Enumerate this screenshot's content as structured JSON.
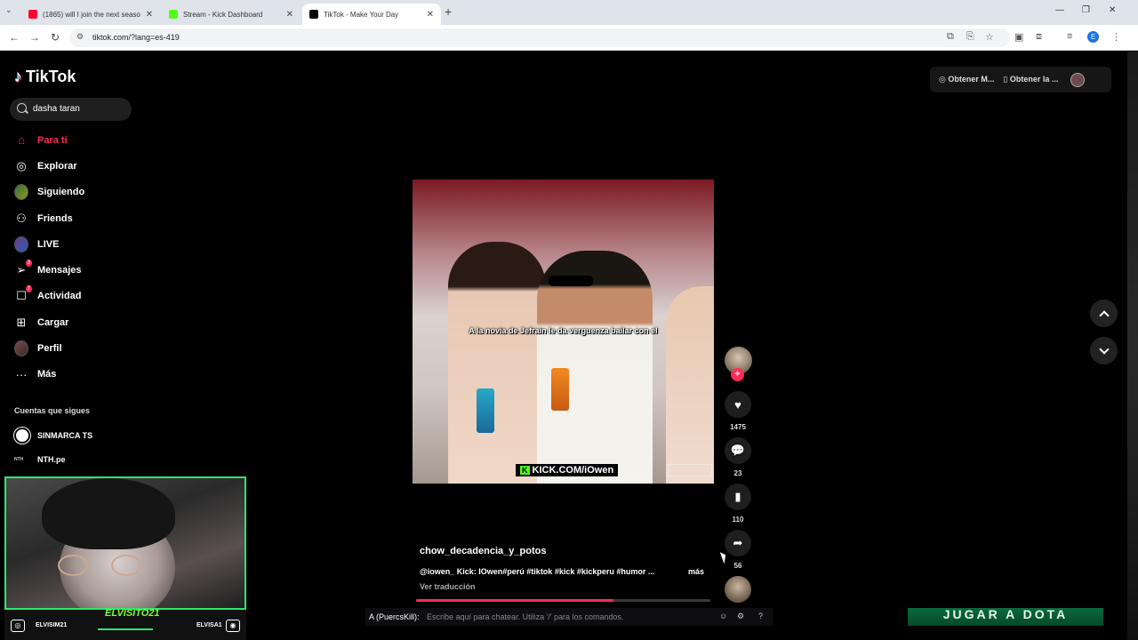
{
  "browser": {
    "tabs": [
      {
        "label": "(1865) will I join the next season",
        "favicon_color": "#ff0033"
      },
      {
        "label": "Stream - Kick Dashboard",
        "favicon_color": "#53fc18"
      },
      {
        "label": "TikTok - Make Your Day",
        "favicon_color": "#000000"
      }
    ],
    "url": "tiktok.com/?lang=es-419",
    "profile_letter": "E"
  },
  "tiktok": {
    "logo": "TikTok",
    "search_value": "dasha taran",
    "nav": [
      {
        "label": "Para ti",
        "icon": "home-icon",
        "active": true
      },
      {
        "label": "Explorar",
        "icon": "compass-icon"
      },
      {
        "label": "Siguiendo",
        "icon": "following-avatar-icon"
      },
      {
        "label": "Friends",
        "icon": "friends-icon"
      },
      {
        "label": "LIVE",
        "icon": "live-avatar-icon"
      },
      {
        "label": "Mensajes",
        "icon": "send-icon",
        "badge": "3"
      },
      {
        "label": "Actividad",
        "icon": "activity-icon",
        "badge": "7"
      },
      {
        "label": "Cargar",
        "icon": "upload-icon"
      },
      {
        "label": "Perfil",
        "icon": "profile-avatar-icon"
      },
      {
        "label": "Más",
        "icon": "more-icon"
      }
    ],
    "following_title": "Cuentas que sigues",
    "following": [
      {
        "name": "SINMARCA TS"
      },
      {
        "name": "NTH.pe",
        "logo_text": "NTH"
      }
    ],
    "top_buttons": [
      "Obtener M...",
      "Obtener la ..."
    ],
    "video": {
      "subtitle": "A la novia de Jefrain le da verguenza bailar con el",
      "watermark": "KICK.COM/iOwen",
      "watermark_k": "K",
      "author": "chow_decadencia_y_potos",
      "caption": "@iowen_ Kick: IOwen#perú #tiktok #kick #kickperu #humor ...",
      "more": "más",
      "translate": "Ver traducción",
      "progress": 0.67
    },
    "actions": {
      "likes": "1475",
      "comments": "23",
      "saves": "110",
      "shares": "56"
    }
  },
  "overlay": {
    "streamer_name": "ELVISITO21",
    "left_handle": "ELVISIM21",
    "right_handle": "ELVISA1",
    "chat_user": "A (PuercsKill):",
    "chat_placeholder": "Escribe aquí para chatear. Utiliza '/' para los comandos.",
    "dota_banner": "JUGAR A DOTA"
  },
  "colors": {
    "tiktok_red": "#fe2c55",
    "kick_green": "#53fc18",
    "cam_border": "#2ee66b"
  }
}
